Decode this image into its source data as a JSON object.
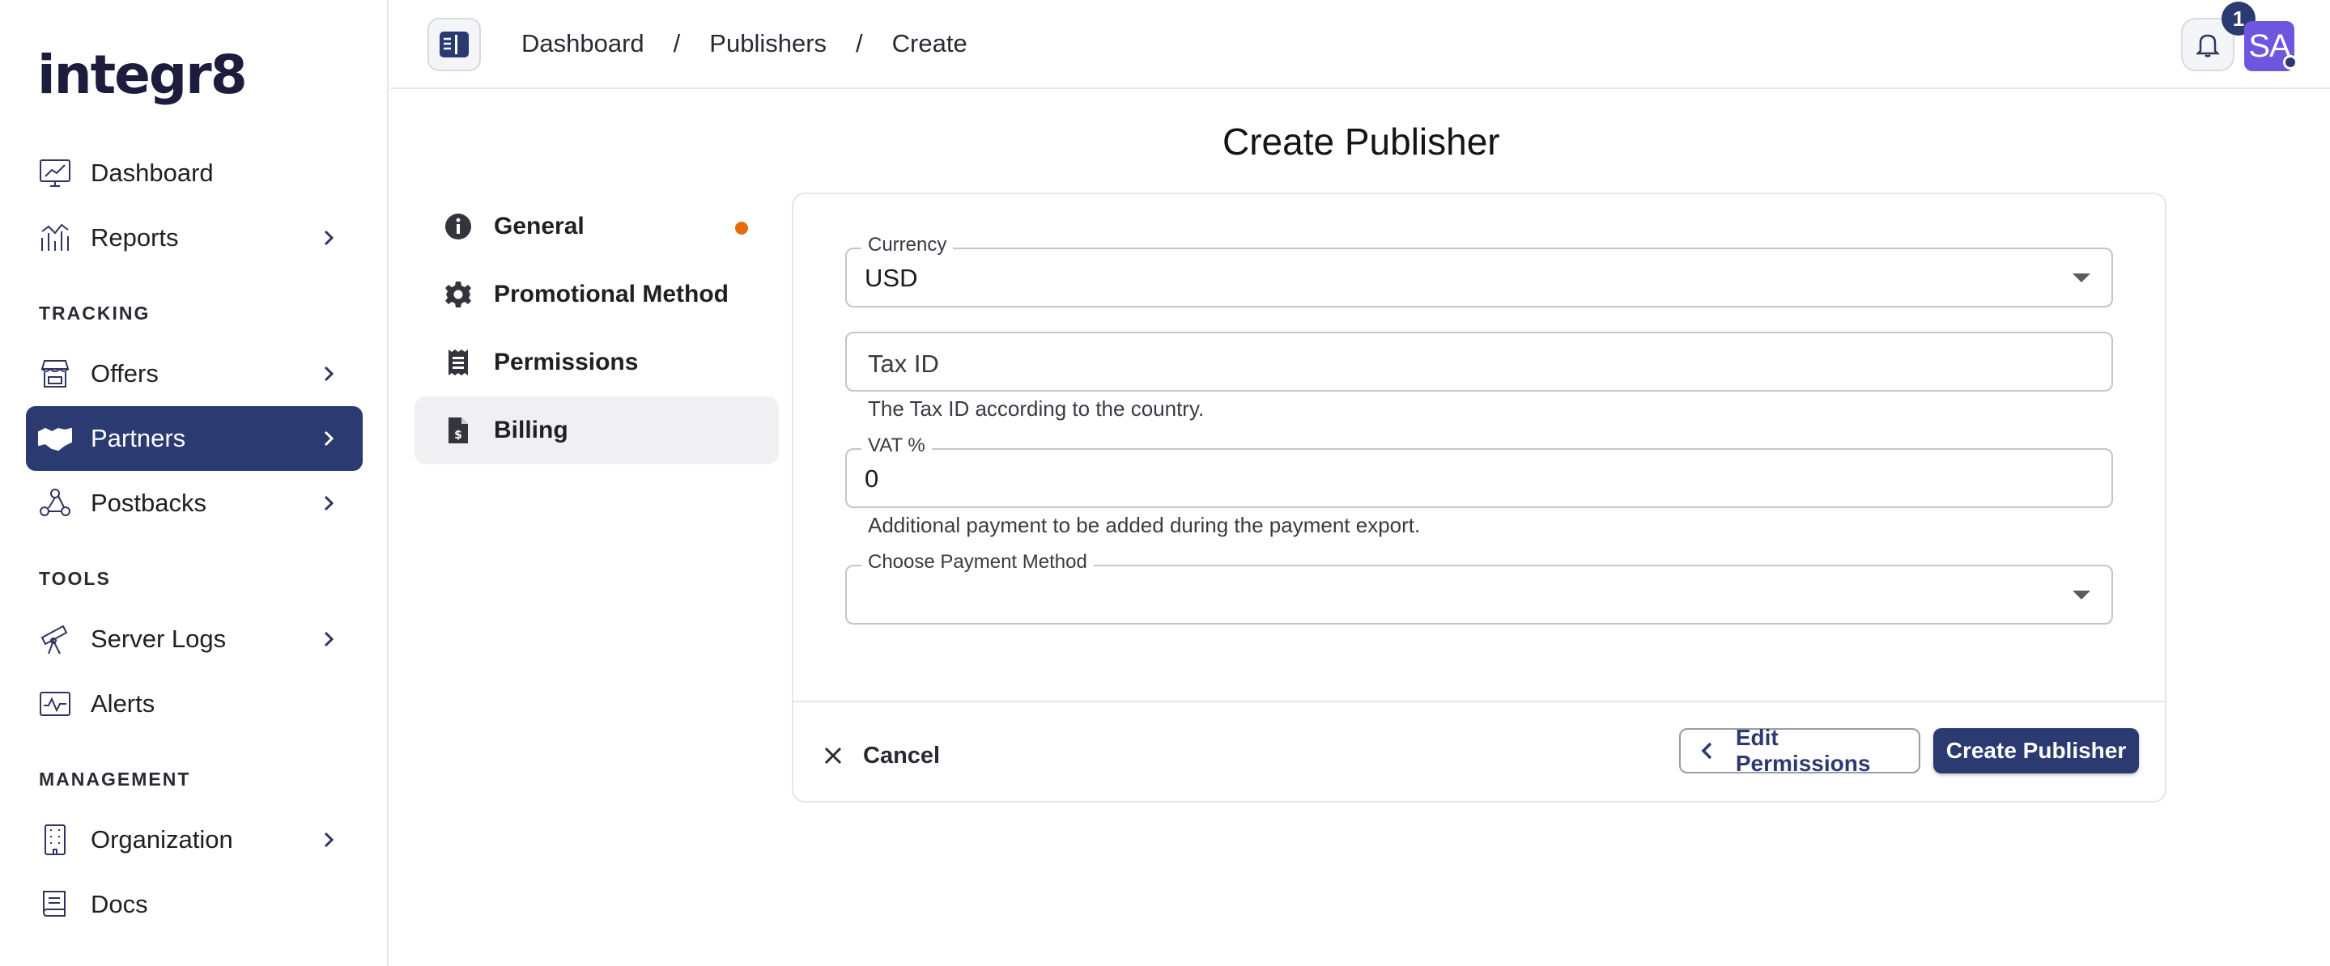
{
  "app": {
    "logo": "integr8"
  },
  "sidebar": {
    "items": [
      {
        "label": "Dashboard"
      },
      {
        "label": "Reports"
      },
      {
        "label": "Offers"
      },
      {
        "label": "Partners"
      },
      {
        "label": "Postbacks"
      },
      {
        "label": "Server Logs"
      },
      {
        "label": "Alerts"
      },
      {
        "label": "Organization"
      },
      {
        "label": "Docs"
      }
    ],
    "sections": {
      "tracking": "TRACKING",
      "tools": "TOOLS",
      "management": "MANAGEMENT"
    },
    "active_color": "#2c3a72"
  },
  "topbar": {
    "breadcrumb": [
      "Dashboard",
      "Publishers",
      "Create"
    ],
    "separator": "/",
    "notification_count": "1",
    "avatar_initials": "SA",
    "avatar_color": "#6f56e0"
  },
  "main": {
    "title": "Create Publisher",
    "steps": [
      {
        "label": "General",
        "icon": "info-icon"
      },
      {
        "label": "Promotional Method",
        "icon": "gear-icon"
      },
      {
        "label": "Permissions",
        "icon": "receipt-icon"
      },
      {
        "label": "Billing",
        "icon": "invoice-dollar-icon"
      }
    ],
    "form": {
      "currency": {
        "label": "Currency",
        "value": "USD"
      },
      "tax_id": {
        "placeholder": "Tax ID",
        "helper": "The Tax ID according to the country."
      },
      "vat": {
        "label": "VAT %",
        "value": "0",
        "helper": "Additional payment to be added during the payment export."
      },
      "payment_method": {
        "label": "Choose Payment Method",
        "value": ""
      }
    },
    "buttons": {
      "cancel": "Cancel",
      "edit_permissions": "Edit Permissions",
      "create": "Create Publisher"
    }
  }
}
